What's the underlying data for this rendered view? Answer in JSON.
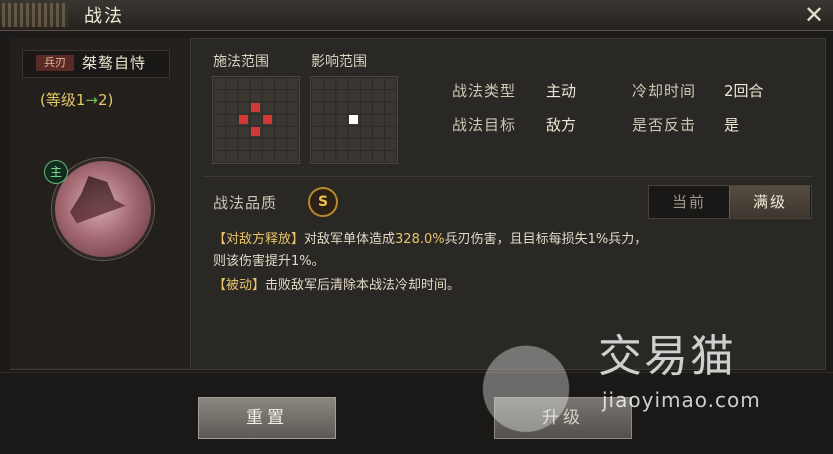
{
  "window": {
    "title": "战法"
  },
  "skill": {
    "type_badge": "兵刃",
    "name": "桀骜自恃",
    "level_prefix": "(等级1",
    "level_arrow": "→",
    "level_suffix": "2)",
    "lead_badge": "主"
  },
  "grids": {
    "cast_range_label": "施法范围",
    "effect_range_label": "影响范围"
  },
  "info": {
    "type_label": "战法类型",
    "type_value": "主动",
    "cooldown_label": "冷却时间",
    "cooldown_value": "2回合",
    "target_label": "战法目标",
    "target_value": "敌方",
    "counter_label": "是否反击",
    "counter_value": "是"
  },
  "quality": {
    "label": "战法品质",
    "grade": "S"
  },
  "toggle": {
    "current": "当前",
    "full": "满级"
  },
  "description": {
    "line1_tag": "【对敌方释放】",
    "line1_pre": "对敌军单体造成",
    "line1_value": "328.0%",
    "line1_post": "兵刃伤害，且目标每损失1%兵力，",
    "line2": "则该伤害提升1%。",
    "line3_tag": "【被动】",
    "line3_text": "击败敌军后清除本战法冷却时间。"
  },
  "buttons": {
    "reset": "重置",
    "upgrade": "升级"
  },
  "watermark": {
    "brand": "交易猫",
    "url": "jiaoyimao.com"
  },
  "colors": {
    "accent_gold": "#e8c36a",
    "range_red": "#d13a32",
    "quality_gold": "#f1c24a"
  }
}
